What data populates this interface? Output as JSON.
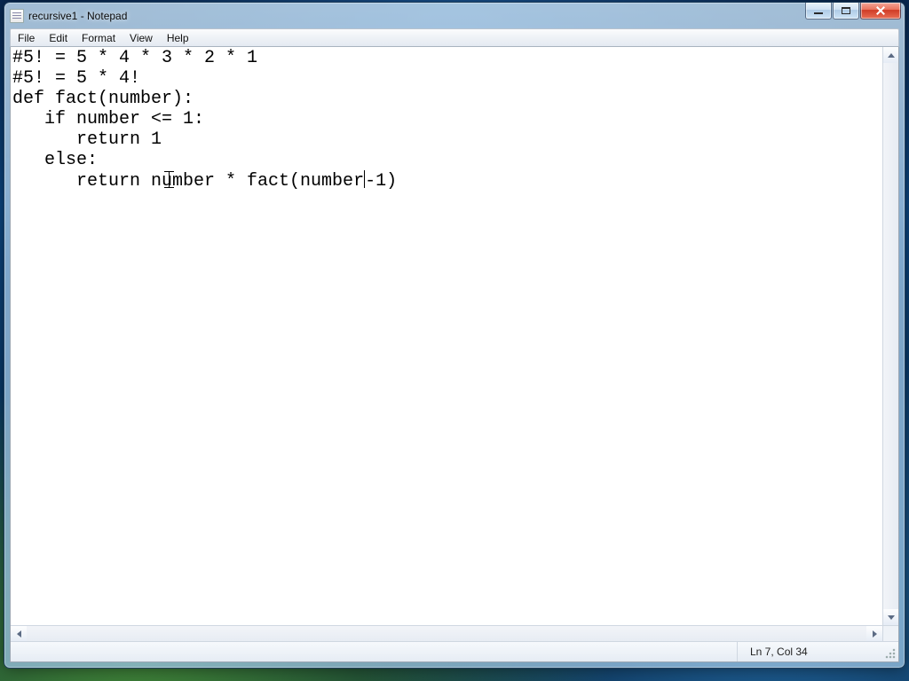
{
  "window": {
    "title": "recursive1 - Notepad"
  },
  "menu": {
    "file": "File",
    "edit": "Edit",
    "format": "Format",
    "view": "View",
    "help": "Help"
  },
  "editor": {
    "lines": [
      "#5! = 5 * 4 * 3 * 2 * 1",
      "#5! = 5 * 4!",
      "def fact(number):",
      "   if number <= 1:",
      "      return 1",
      "   else:",
      "      return number * fact(number-1)"
    ],
    "cursor": {
      "line": 7,
      "col": 34
    }
  },
  "status": {
    "position": "Ln 7, Col 34"
  },
  "icons": {
    "minimize": "minimize-icon",
    "maximize": "maximize-icon",
    "close": "close-icon"
  }
}
